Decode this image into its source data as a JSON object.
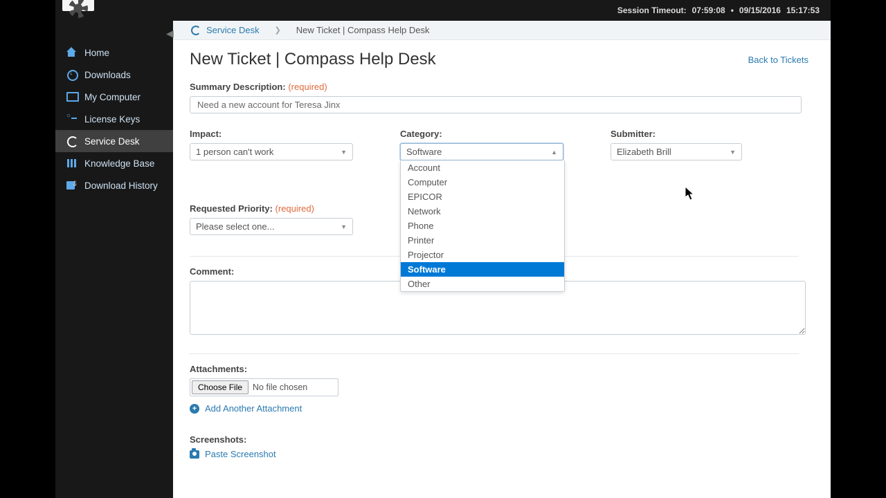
{
  "statusBar": {
    "timeoutLabel": "Session Timeout:",
    "timeoutValue": "07:59:08",
    "sep": "•",
    "date": "09/15/2016",
    "time": "15:17:53"
  },
  "sidebar": {
    "items": [
      {
        "label": "Home"
      },
      {
        "label": "Downloads"
      },
      {
        "label": "My Computer"
      },
      {
        "label": "License Keys"
      },
      {
        "label": "Service Desk"
      },
      {
        "label": "Knowledge Base"
      },
      {
        "label": "Download History"
      }
    ]
  },
  "breadcrumb": {
    "root": "Service Desk",
    "current": "New Ticket | Compass Help Desk"
  },
  "page": {
    "title": "New Ticket | Compass Help Desk",
    "backLink": "Back to Tickets"
  },
  "form": {
    "summary": {
      "label": "Summary Description:",
      "required": "(required)",
      "value": "Need a new account for Teresa Jinx"
    },
    "impact": {
      "label": "Impact:",
      "value": "1 person can't work"
    },
    "category": {
      "label": "Category:",
      "value": "Software",
      "options": [
        "Account",
        "Computer",
        "EPICOR",
        "Network",
        "Phone",
        "Printer",
        "Projector",
        "Software",
        "Other"
      ]
    },
    "submitter": {
      "label": "Submitter:",
      "value": "Elizabeth Brill"
    },
    "priority": {
      "label": "Requested Priority:",
      "required": "(required)",
      "value": "Please select one..."
    },
    "comment": {
      "label": "Comment:"
    },
    "attachments": {
      "label": "Attachments:",
      "button": "Choose File",
      "noneText": "No file chosen",
      "addAnother": "Add Another Attachment"
    },
    "screenshots": {
      "label": "Screenshots:",
      "paste": "Paste Screenshot"
    }
  }
}
